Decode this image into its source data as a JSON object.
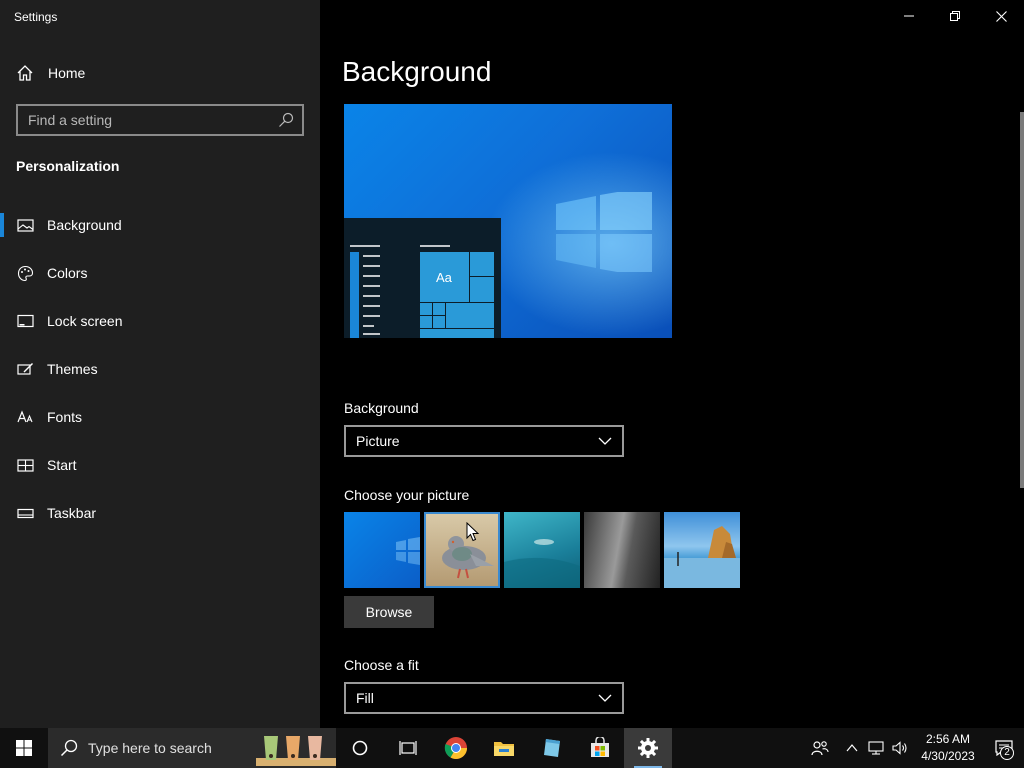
{
  "window": {
    "title": "Settings",
    "minimize_icon": "minimize-icon",
    "restore_icon": "restore-icon",
    "close_icon": "close-icon"
  },
  "sidebar": {
    "home_label": "Home",
    "search_placeholder": "Find a setting",
    "section_title": "Personalization",
    "items": [
      {
        "label": "Background",
        "icon": "picture-icon",
        "active": true
      },
      {
        "label": "Colors",
        "icon": "palette-icon",
        "active": false
      },
      {
        "label": "Lock screen",
        "icon": "lock-screen-icon",
        "active": false
      },
      {
        "label": "Themes",
        "icon": "themes-icon",
        "active": false
      },
      {
        "label": "Fonts",
        "icon": "fonts-icon",
        "active": false
      },
      {
        "label": "Start",
        "icon": "start-icon",
        "active": false
      },
      {
        "label": "Taskbar",
        "icon": "taskbar-icon",
        "active": false
      }
    ]
  },
  "main": {
    "title": "Background",
    "preview_tile_text": "Aa",
    "background_label": "Background",
    "background_value": "Picture",
    "choose_picture_label": "Choose your picture",
    "browse_label": "Browse",
    "choose_fit_label": "Choose a fit",
    "fit_value": "Fill"
  },
  "taskbar": {
    "search_placeholder": "Type here to search",
    "time": "2:56 AM",
    "date": "4/30/2023",
    "notification_count": "2"
  },
  "colors": {
    "accent": "#1a86d8",
    "sidebar_bg": "#1f1f1f",
    "main_bg": "#000000",
    "taskbar_bg": "#101010"
  }
}
